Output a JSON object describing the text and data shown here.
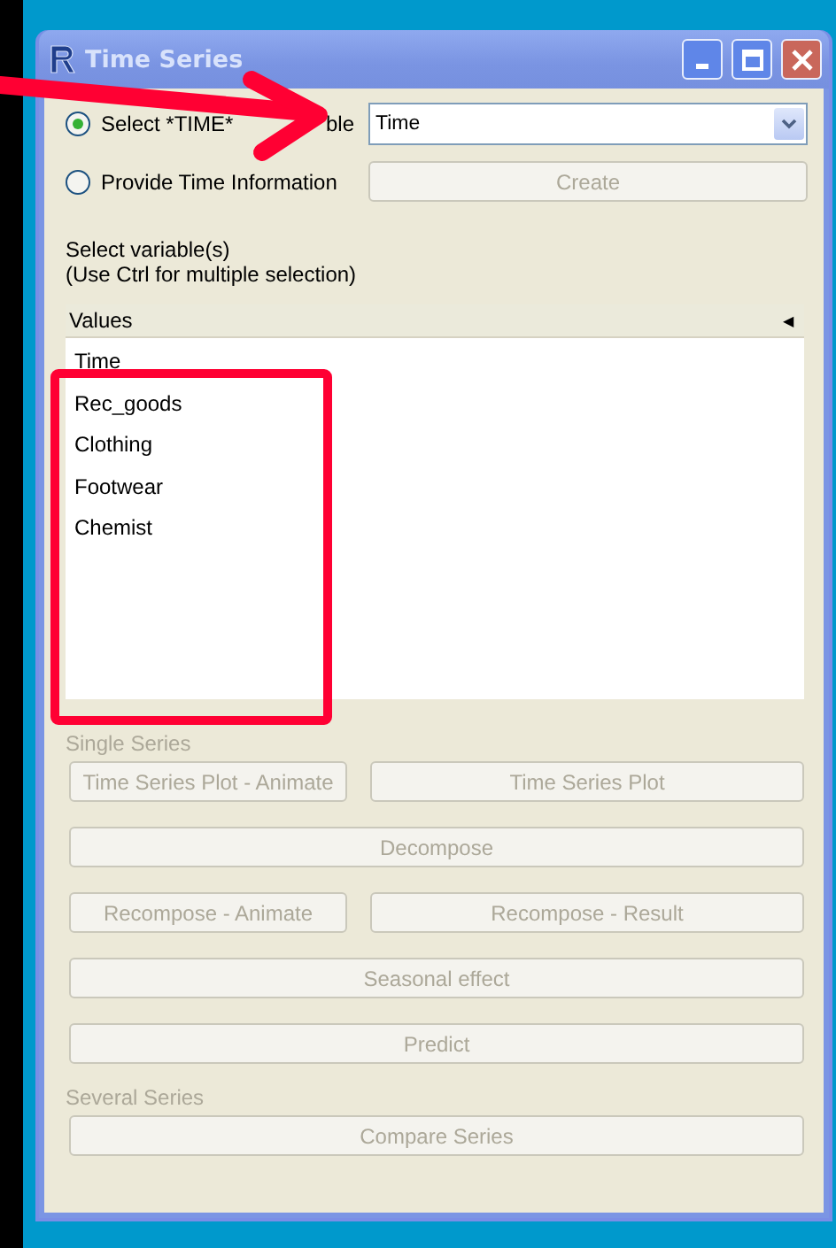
{
  "window": {
    "title": "Time Series"
  },
  "time_options": [
    {
      "label": "Select *TIME*",
      "label_tail": "ble",
      "selected": true
    },
    {
      "label": "Provide Time Information",
      "selected": false
    }
  ],
  "time_variable": {
    "value": "Time"
  },
  "create_button": {
    "label": "Create",
    "disabled": true
  },
  "instructions": [
    "Select variable(s)",
    "(Use Ctrl for multiple selection)"
  ],
  "variables": {
    "header": "Values",
    "sort_indicator": "◀",
    "items": [
      {
        "label": "Time",
        "selected": false
      },
      {
        "label": "Rec_goods",
        "selected": false
      },
      {
        "label": "Clothing",
        "selected": false
      },
      {
        "label": "Footwear",
        "selected": false
      },
      {
        "label": "Chemist",
        "selected": false
      }
    ]
  },
  "sections": [
    {
      "heading": "Single Series",
      "disabled": true,
      "rows": [
        [
          "Time Series Plot - Animate",
          "Time Series Plot"
        ],
        [
          "Decompose"
        ],
        [
          "Recompose - Animate",
          "Recompose - Result"
        ],
        [
          "Seasonal effect"
        ],
        [
          "Predict"
        ]
      ]
    },
    {
      "heading": "Several Series",
      "disabled": true,
      "rows": [
        [
          "Compare Series"
        ]
      ]
    }
  ],
  "annotations": [
    {
      "kind": "arrow"
    },
    {
      "kind": "frame"
    }
  ]
}
